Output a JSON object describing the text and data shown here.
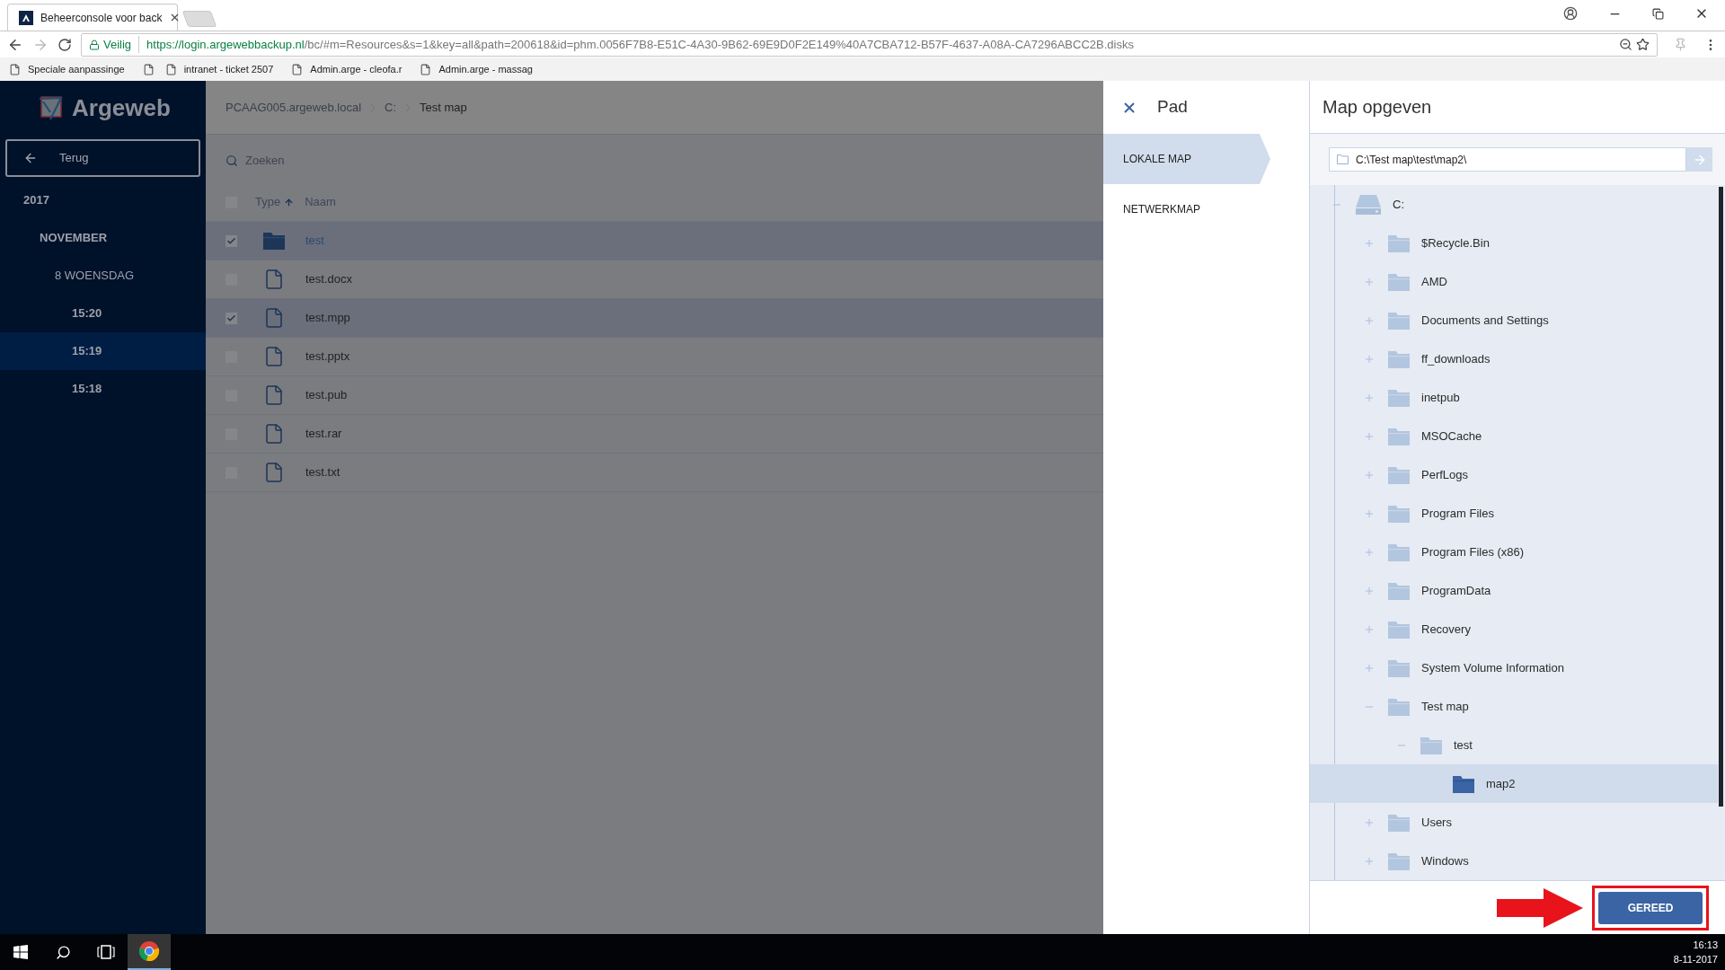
{
  "browser": {
    "tab": {
      "title": "Beheerconsole voor back"
    },
    "secure_label": "Veilig",
    "url": {
      "host": "https://login.argewebbackup.nl",
      "path": "/bc/#m=Resources&s=1&key=all&path=200618&id=phm.0056F7B8-E51C-4A30-9B62-69E9D0F2E149%40A7CBA712-B57F-4637-A08A-CA7296ABCC2B.disks"
    },
    "bookmarks": [
      {
        "kind": "page",
        "label": "Speciale aanpassinge"
      },
      {
        "kind": "blank"
      },
      {
        "kind": "page",
        "label": "intranet - ticket 2507"
      },
      {
        "kind": "page",
        "label": "Admin.arge - cleofa.r"
      },
      {
        "kind": "page",
        "label": "Admin.arge - massag"
      }
    ]
  },
  "app": {
    "logo": "Argeweb",
    "back_button": "Terug",
    "timeline": [
      {
        "label": "2017",
        "selected": false,
        "children": [
          {
            "label": "NOVEMBER",
            "selected": false,
            "children": [
              {
                "label": "8 WOENSDAG",
                "selected": false,
                "children": [
                  {
                    "label": "15:20",
                    "selected": false
                  },
                  {
                    "label": "15:19",
                    "selected": true
                  },
                  {
                    "label": "15:18",
                    "selected": false
                  }
                ]
              }
            ]
          }
        ]
      }
    ],
    "breadcrumb": [
      "PCAAG005.argeweb.local",
      "C:",
      "Test map"
    ],
    "search": {
      "placeholder": "Zoeken"
    },
    "select_all": {
      "checked": false
    },
    "columns": [
      "Type",
      "Naam"
    ],
    "files": [
      {
        "kind": "folder",
        "name": "test",
        "checked": true
      },
      {
        "kind": "file",
        "name": "test.docx",
        "checked": false
      },
      {
        "kind": "file",
        "name": "test.mpp",
        "checked": true
      },
      {
        "kind": "file",
        "name": "test.pptx",
        "checked": false
      },
      {
        "kind": "file",
        "name": "test.pub",
        "checked": false
      },
      {
        "kind": "file",
        "name": "test.rar",
        "checked": false
      },
      {
        "kind": "file",
        "name": "test.txt",
        "checked": false
      }
    ]
  },
  "path_panel": {
    "title": "Pad",
    "tabs": [
      {
        "label": "LOKALE MAP",
        "selected": true
      },
      {
        "label": "NETWERKMAP",
        "selected": false
      }
    ]
  },
  "folder_panel": {
    "title": "Map opgeven",
    "path_value": "C:\\Test map\\test\\map2\\",
    "tree": [
      {
        "kind": "drive",
        "name": "C:",
        "expanded": true,
        "selected": false,
        "children": [
          {
            "kind": "folder",
            "name": "$Recycle.Bin",
            "expanded": false,
            "selected": false
          },
          {
            "kind": "folder",
            "name": "AMD",
            "expanded": false,
            "selected": false
          },
          {
            "kind": "folder",
            "name": "Documents and Settings",
            "expanded": false,
            "selected": false
          },
          {
            "kind": "folder",
            "name": "ff_downloads",
            "expanded": false,
            "selected": false
          },
          {
            "kind": "folder",
            "name": "inetpub",
            "expanded": false,
            "selected": false
          },
          {
            "kind": "folder",
            "name": "MSOCache",
            "expanded": false,
            "selected": false
          },
          {
            "kind": "folder",
            "name": "PerfLogs",
            "expanded": false,
            "selected": false
          },
          {
            "kind": "folder",
            "name": "Program Files",
            "expanded": false,
            "selected": false
          },
          {
            "kind": "folder",
            "name": "Program Files (x86)",
            "expanded": false,
            "selected": false
          },
          {
            "kind": "folder",
            "name": "ProgramData",
            "expanded": false,
            "selected": false
          },
          {
            "kind": "folder",
            "name": "Recovery",
            "expanded": false,
            "selected": false
          },
          {
            "kind": "folder",
            "name": "System Volume Information",
            "expanded": false,
            "selected": false
          },
          {
            "kind": "folder",
            "name": "Test map",
            "expanded": true,
            "selected": false,
            "children": [
              {
                "kind": "folder",
                "name": "test",
                "expanded": true,
                "selected": false,
                "children": [
                  {
                    "kind": "folder",
                    "name": "map2",
                    "selected": true
                  }
                ]
              }
            ]
          },
          {
            "kind": "folder",
            "name": "Users",
            "expanded": false,
            "selected": false
          },
          {
            "kind": "folder",
            "name": "Windows",
            "expanded": false,
            "selected": false
          }
        ]
      }
    ],
    "done_button": "GEREED"
  },
  "taskbar": {
    "time": "16:13",
    "date": "8-11-2017"
  }
}
